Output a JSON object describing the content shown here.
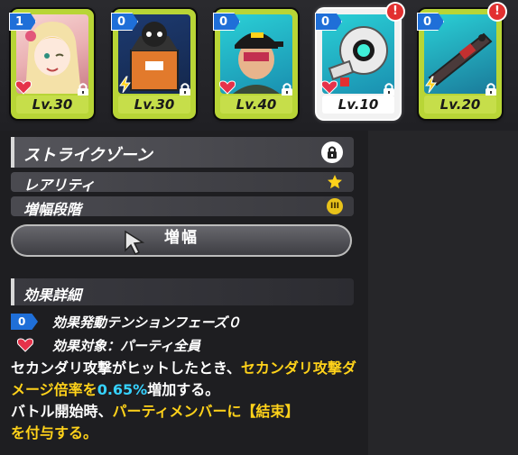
{
  "cards": [
    {
      "badge": "1",
      "level": "Lv.30",
      "selected": false,
      "alert": false,
      "type_icon": "heart-icon",
      "art_color": "#f2b3b8"
    },
    {
      "badge": "0",
      "level": "Lv.30",
      "selected": false,
      "alert": false,
      "type_icon": "bolt-icon",
      "art_color": "#1d3a70"
    },
    {
      "badge": "0",
      "level": "Lv.40",
      "selected": false,
      "alert": false,
      "type_icon": "heart-icon",
      "art_color": "#2ba7c4"
    },
    {
      "badge": "0",
      "level": "Lv.10",
      "selected": true,
      "alert": true,
      "type_icon": "heart-icon",
      "art_color": "#2aaec0"
    },
    {
      "badge": "0",
      "level": "Lv.20",
      "selected": false,
      "alert": true,
      "type_icon": "bolt-icon",
      "art_color": "#1f6e8f"
    }
  ],
  "alert_mark": "!",
  "strike_zone": {
    "title": "ストライクゾーン"
  },
  "rarity": {
    "label": "レアリティ"
  },
  "aug_stage": {
    "label": "増幅段階",
    "icon_text": "III"
  },
  "augment_button": {
    "label": "増幅"
  },
  "effect": {
    "header": "効果詳細",
    "phase_badge": "0",
    "phase_text": "効果発動テンションフェーズ０",
    "target_text": "効果対象：パーティ全員",
    "desc": {
      "p1": "セカンダリ攻撃がヒットしたとき、",
      "p1y": "セカンダリ攻撃ダメージ倍率を",
      "p1c": "0.65%",
      "p1e": "増加する。",
      "p2": "バトル開始時、",
      "p2y": "パーティメンバーに【結束】",
      "p3y": "を付与する。"
    }
  },
  "colors": {
    "accent_green": "#b8d536",
    "badge_blue": "#1f6fd8",
    "highlight_yellow": "#ffd21a",
    "highlight_cyan": "#36d2ff",
    "alert_red": "#e23030"
  }
}
